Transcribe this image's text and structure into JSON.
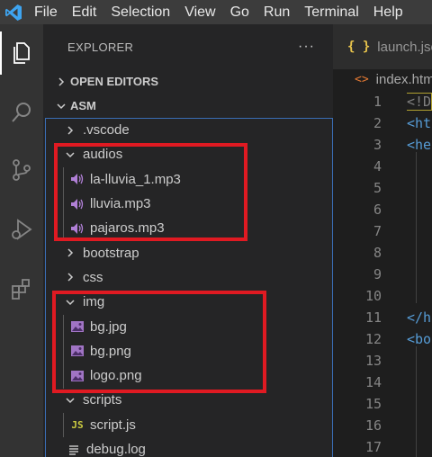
{
  "menubar": {
    "items": [
      {
        "label": "File"
      },
      {
        "label": "Edit"
      },
      {
        "label": "Selection"
      },
      {
        "label": "View"
      },
      {
        "label": "Go"
      },
      {
        "label": "Run"
      },
      {
        "label": "Terminal"
      },
      {
        "label": "Help"
      }
    ]
  },
  "activitybar": {
    "icons": [
      "explorer-icon",
      "search-icon",
      "source-control-icon",
      "run-debug-icon",
      "extensions-icon"
    ]
  },
  "sidebar": {
    "title": "EXPLORER",
    "more": "···",
    "open_editors": "OPEN EDITORS",
    "workspace": "ASM",
    "tree": [
      {
        "label": ".vscode",
        "type": "folder",
        "expanded": false
      },
      {
        "label": "audios",
        "type": "folder",
        "expanded": true
      },
      {
        "label": "la-lluvia_1.mp3",
        "type": "audio"
      },
      {
        "label": "lluvia.mp3",
        "type": "audio"
      },
      {
        "label": "pajaros.mp3",
        "type": "audio"
      },
      {
        "label": "bootstrap",
        "type": "folder",
        "expanded": false
      },
      {
        "label": "css",
        "type": "folder",
        "expanded": false
      },
      {
        "label": "img",
        "type": "folder",
        "expanded": true
      },
      {
        "label": "bg.jpg",
        "type": "image"
      },
      {
        "label": "bg.png",
        "type": "image"
      },
      {
        "label": "logo.png",
        "type": "image"
      },
      {
        "label": "scripts",
        "type": "folder",
        "expanded": true
      },
      {
        "label": "script.js",
        "type": "js"
      },
      {
        "label": "debug.log",
        "type": "log"
      }
    ]
  },
  "editor": {
    "tab_label": "launch.json",
    "tab_icon": "{ }",
    "breadcrumb_label": "index.html",
    "breadcrumb_icon": "<>",
    "line_numbers": [
      "1",
      "2",
      "3",
      "4",
      "5",
      "6",
      "7",
      "8",
      "9",
      "10",
      "11",
      "12",
      "13",
      "14",
      "15",
      "16",
      "17"
    ],
    "code_lines": [
      {
        "line": 1,
        "text": "<!D"
      },
      {
        "line": 2,
        "text": "<ht"
      },
      {
        "line": 3,
        "text": "<he"
      },
      {
        "line": 11,
        "text": "</h"
      },
      {
        "line": 12,
        "text": "<bo"
      }
    ]
  },
  "colors": {
    "accent": "#007acc",
    "annotation": "#e01a22",
    "audio_icon": "#b180d7",
    "image_icon": "#a074c4",
    "js_icon": "#cbcb41"
  }
}
